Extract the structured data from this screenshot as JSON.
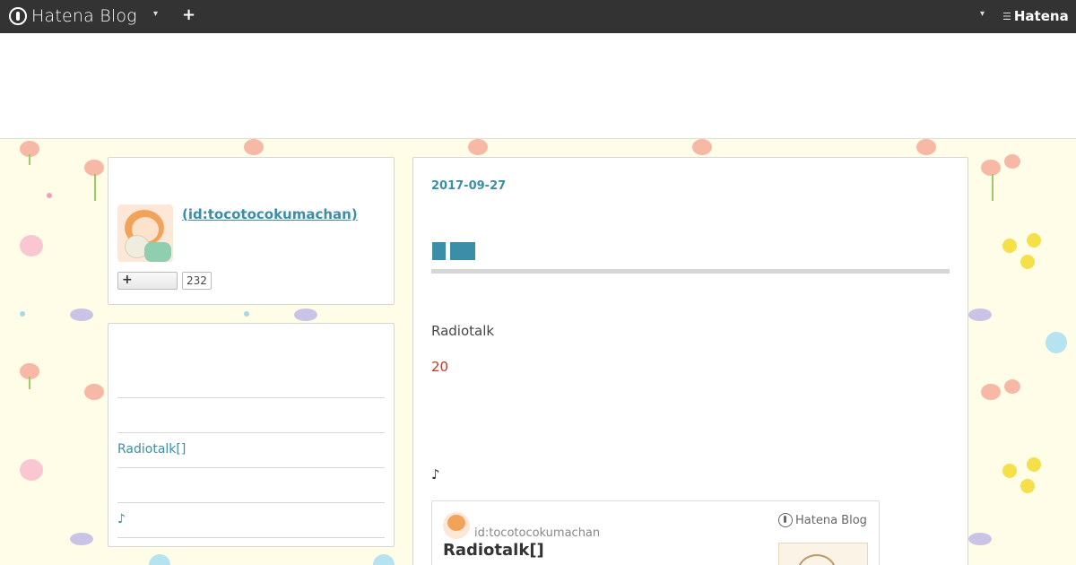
{
  "topbar": {
    "logo_text": "Hatena Blog",
    "plus": "+",
    "caret": "▾",
    "hatena_text": "Hatena",
    "hatena_mark": "☰"
  },
  "profile": {
    "id_link": " (id:tocotocokumachan)",
    "subscribe_label": "+",
    "subscriber_count": "232"
  },
  "sidebar_list": {
    "items": [
      "",
      "Radiotalk[]",
      "",
      "♪",
      ""
    ]
  },
  "article": {
    "date": "2017-09-27",
    "para1": "Radiotalk",
    "para2": "20",
    "para3": "♪",
    "embed": {
      "user": "id:tocotocokumachan",
      "title": "Radiotalk[]",
      "brand": "Hatena Blog"
    }
  },
  "colors": {
    "accent": "#3b8ea8",
    "topbar_bg": "#333333",
    "page_bg": "#fffde8",
    "highlight": "#c0392b"
  }
}
